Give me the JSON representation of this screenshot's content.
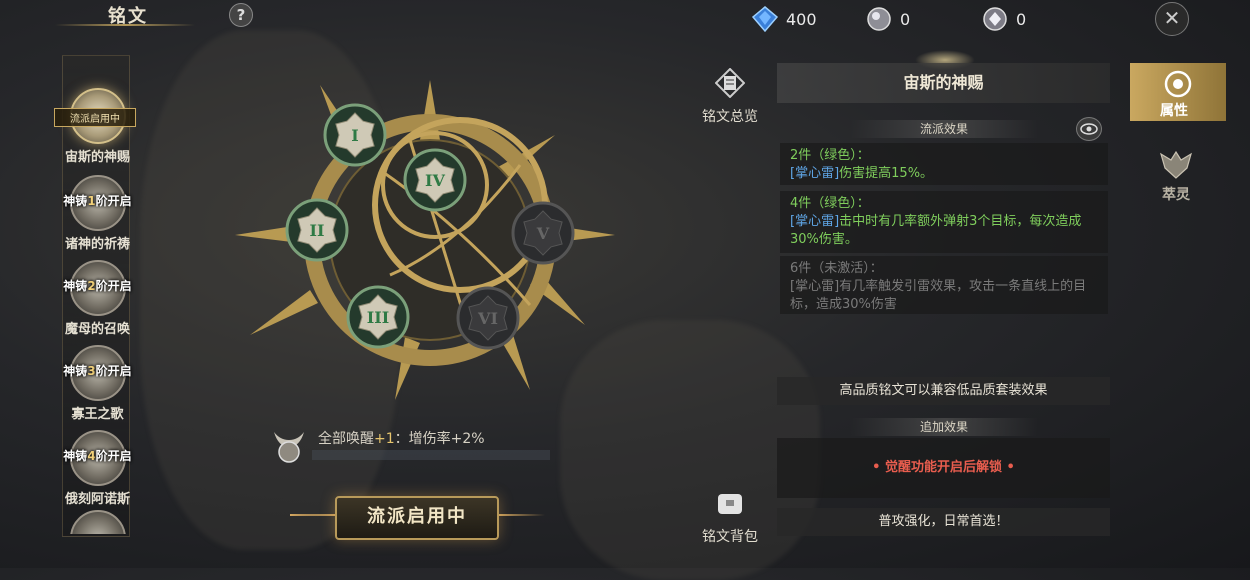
{
  "header": {
    "title": "铭文",
    "help": "?"
  },
  "currencies": [
    {
      "icon": "blue-crystal-icon",
      "value": "400"
    },
    {
      "icon": "silver-orb-icon",
      "value": "0"
    },
    {
      "icon": "silver-gem-icon",
      "value": "0"
    }
  ],
  "left_list": [
    {
      "name": "宙斯的神赐",
      "status": "流派启用中",
      "active": true
    },
    {
      "name": "诸神的祈祷",
      "lock_prefix": "神铸",
      "lock_num": "1",
      "lock_suffix": "阶开启"
    },
    {
      "name": "魔母的召唤",
      "lock_prefix": "神铸",
      "lock_num": "2",
      "lock_suffix": "阶开启"
    },
    {
      "name": "寡王之歌",
      "lock_prefix": "神铸",
      "lock_num": "3",
      "lock_suffix": "阶开启"
    },
    {
      "name": "俄刻阿诺斯",
      "lock_prefix": "神铸",
      "lock_num": "4",
      "lock_suffix": "阶开启"
    }
  ],
  "diagram": {
    "slots": [
      {
        "label": "I",
        "state": "active"
      },
      {
        "label": "II",
        "state": "active"
      },
      {
        "label": "III",
        "state": "active"
      },
      {
        "label": "IV",
        "state": "active"
      },
      {
        "label": "V",
        "state": "inactive"
      },
      {
        "label": "VI",
        "state": "inactive"
      }
    ]
  },
  "awaken": {
    "prefix": "全部唤醒",
    "bonus": "+1",
    "text": "：增伤率+2%"
  },
  "active_button": "流派启用中",
  "mid_buttons": {
    "overview": "铭文总览",
    "bag": "铭文背包"
  },
  "panel": {
    "title": "宙斯的神赐",
    "school_effect": "流派效果",
    "sets": [
      {
        "head": "2件（绿色）：",
        "kw": "[掌心雷]",
        "body": "伤害提高15%。",
        "active": true
      },
      {
        "head": "4件（绿色）：",
        "kw": "[掌心雷]",
        "body": "击中时有几率额外弹射3个目标，每次造成30%伤害。",
        "active": true
      },
      {
        "head": "6件（未激活）：",
        "kw": "[掌心雷]",
        "body": "有几率触发引雷效果，攻击一条直线上的目标，造成30%伤害",
        "active": false
      }
    ],
    "compat_note": "高品质铭文可以兼容低品质套装效果",
    "extra_effect": "追加效果",
    "unlock_note": "• 觉醒功能开启后解锁 •",
    "footer_note": "普攻强化，日常首选！"
  },
  "right_tabs": {
    "attr": "属性",
    "soul": "萃灵"
  },
  "colors": {
    "gold": "#c9a85e",
    "green": "#7fce5c",
    "keyword": "#5fa6e6",
    "warn": "#e85d4e"
  }
}
